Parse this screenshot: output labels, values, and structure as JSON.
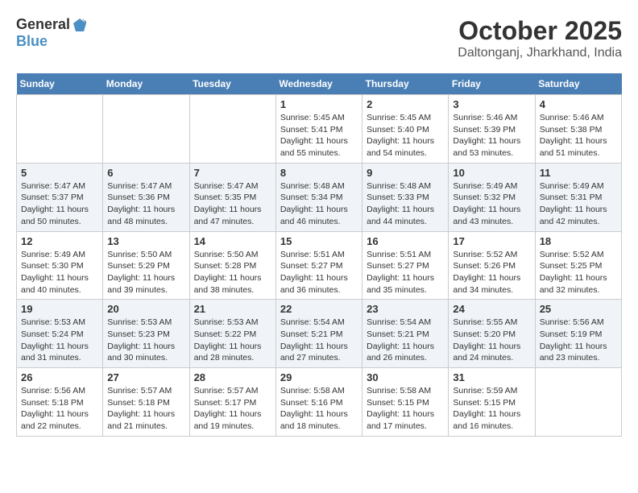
{
  "header": {
    "logo_general": "General",
    "logo_blue": "Blue",
    "month": "October 2025",
    "location": "Daltonganj, Jharkhand, India"
  },
  "days_of_week": [
    "Sunday",
    "Monday",
    "Tuesday",
    "Wednesday",
    "Thursday",
    "Friday",
    "Saturday"
  ],
  "weeks": [
    [
      {
        "day": "",
        "info": ""
      },
      {
        "day": "",
        "info": ""
      },
      {
        "day": "",
        "info": ""
      },
      {
        "day": "1",
        "info": "Sunrise: 5:45 AM\nSunset: 5:41 PM\nDaylight: 11 hours\nand 55 minutes."
      },
      {
        "day": "2",
        "info": "Sunrise: 5:45 AM\nSunset: 5:40 PM\nDaylight: 11 hours\nand 54 minutes."
      },
      {
        "day": "3",
        "info": "Sunrise: 5:46 AM\nSunset: 5:39 PM\nDaylight: 11 hours\nand 53 minutes."
      },
      {
        "day": "4",
        "info": "Sunrise: 5:46 AM\nSunset: 5:38 PM\nDaylight: 11 hours\nand 51 minutes."
      }
    ],
    [
      {
        "day": "5",
        "info": "Sunrise: 5:47 AM\nSunset: 5:37 PM\nDaylight: 11 hours\nand 50 minutes."
      },
      {
        "day": "6",
        "info": "Sunrise: 5:47 AM\nSunset: 5:36 PM\nDaylight: 11 hours\nand 48 minutes."
      },
      {
        "day": "7",
        "info": "Sunrise: 5:47 AM\nSunset: 5:35 PM\nDaylight: 11 hours\nand 47 minutes."
      },
      {
        "day": "8",
        "info": "Sunrise: 5:48 AM\nSunset: 5:34 PM\nDaylight: 11 hours\nand 46 minutes."
      },
      {
        "day": "9",
        "info": "Sunrise: 5:48 AM\nSunset: 5:33 PM\nDaylight: 11 hours\nand 44 minutes."
      },
      {
        "day": "10",
        "info": "Sunrise: 5:49 AM\nSunset: 5:32 PM\nDaylight: 11 hours\nand 43 minutes."
      },
      {
        "day": "11",
        "info": "Sunrise: 5:49 AM\nSunset: 5:31 PM\nDaylight: 11 hours\nand 42 minutes."
      }
    ],
    [
      {
        "day": "12",
        "info": "Sunrise: 5:49 AM\nSunset: 5:30 PM\nDaylight: 11 hours\nand 40 minutes."
      },
      {
        "day": "13",
        "info": "Sunrise: 5:50 AM\nSunset: 5:29 PM\nDaylight: 11 hours\nand 39 minutes."
      },
      {
        "day": "14",
        "info": "Sunrise: 5:50 AM\nSunset: 5:28 PM\nDaylight: 11 hours\nand 38 minutes."
      },
      {
        "day": "15",
        "info": "Sunrise: 5:51 AM\nSunset: 5:27 PM\nDaylight: 11 hours\nand 36 minutes."
      },
      {
        "day": "16",
        "info": "Sunrise: 5:51 AM\nSunset: 5:27 PM\nDaylight: 11 hours\nand 35 minutes."
      },
      {
        "day": "17",
        "info": "Sunrise: 5:52 AM\nSunset: 5:26 PM\nDaylight: 11 hours\nand 34 minutes."
      },
      {
        "day": "18",
        "info": "Sunrise: 5:52 AM\nSunset: 5:25 PM\nDaylight: 11 hours\nand 32 minutes."
      }
    ],
    [
      {
        "day": "19",
        "info": "Sunrise: 5:53 AM\nSunset: 5:24 PM\nDaylight: 11 hours\nand 31 minutes."
      },
      {
        "day": "20",
        "info": "Sunrise: 5:53 AM\nSunset: 5:23 PM\nDaylight: 11 hours\nand 30 minutes."
      },
      {
        "day": "21",
        "info": "Sunrise: 5:53 AM\nSunset: 5:22 PM\nDaylight: 11 hours\nand 28 minutes."
      },
      {
        "day": "22",
        "info": "Sunrise: 5:54 AM\nSunset: 5:21 PM\nDaylight: 11 hours\nand 27 minutes."
      },
      {
        "day": "23",
        "info": "Sunrise: 5:54 AM\nSunset: 5:21 PM\nDaylight: 11 hours\nand 26 minutes."
      },
      {
        "day": "24",
        "info": "Sunrise: 5:55 AM\nSunset: 5:20 PM\nDaylight: 11 hours\nand 24 minutes."
      },
      {
        "day": "25",
        "info": "Sunrise: 5:56 AM\nSunset: 5:19 PM\nDaylight: 11 hours\nand 23 minutes."
      }
    ],
    [
      {
        "day": "26",
        "info": "Sunrise: 5:56 AM\nSunset: 5:18 PM\nDaylight: 11 hours\nand 22 minutes."
      },
      {
        "day": "27",
        "info": "Sunrise: 5:57 AM\nSunset: 5:18 PM\nDaylight: 11 hours\nand 21 minutes."
      },
      {
        "day": "28",
        "info": "Sunrise: 5:57 AM\nSunset: 5:17 PM\nDaylight: 11 hours\nand 19 minutes."
      },
      {
        "day": "29",
        "info": "Sunrise: 5:58 AM\nSunset: 5:16 PM\nDaylight: 11 hours\nand 18 minutes."
      },
      {
        "day": "30",
        "info": "Sunrise: 5:58 AM\nSunset: 5:15 PM\nDaylight: 11 hours\nand 17 minutes."
      },
      {
        "day": "31",
        "info": "Sunrise: 5:59 AM\nSunset: 5:15 PM\nDaylight: 11 hours\nand 16 minutes."
      },
      {
        "day": "",
        "info": ""
      }
    ]
  ]
}
